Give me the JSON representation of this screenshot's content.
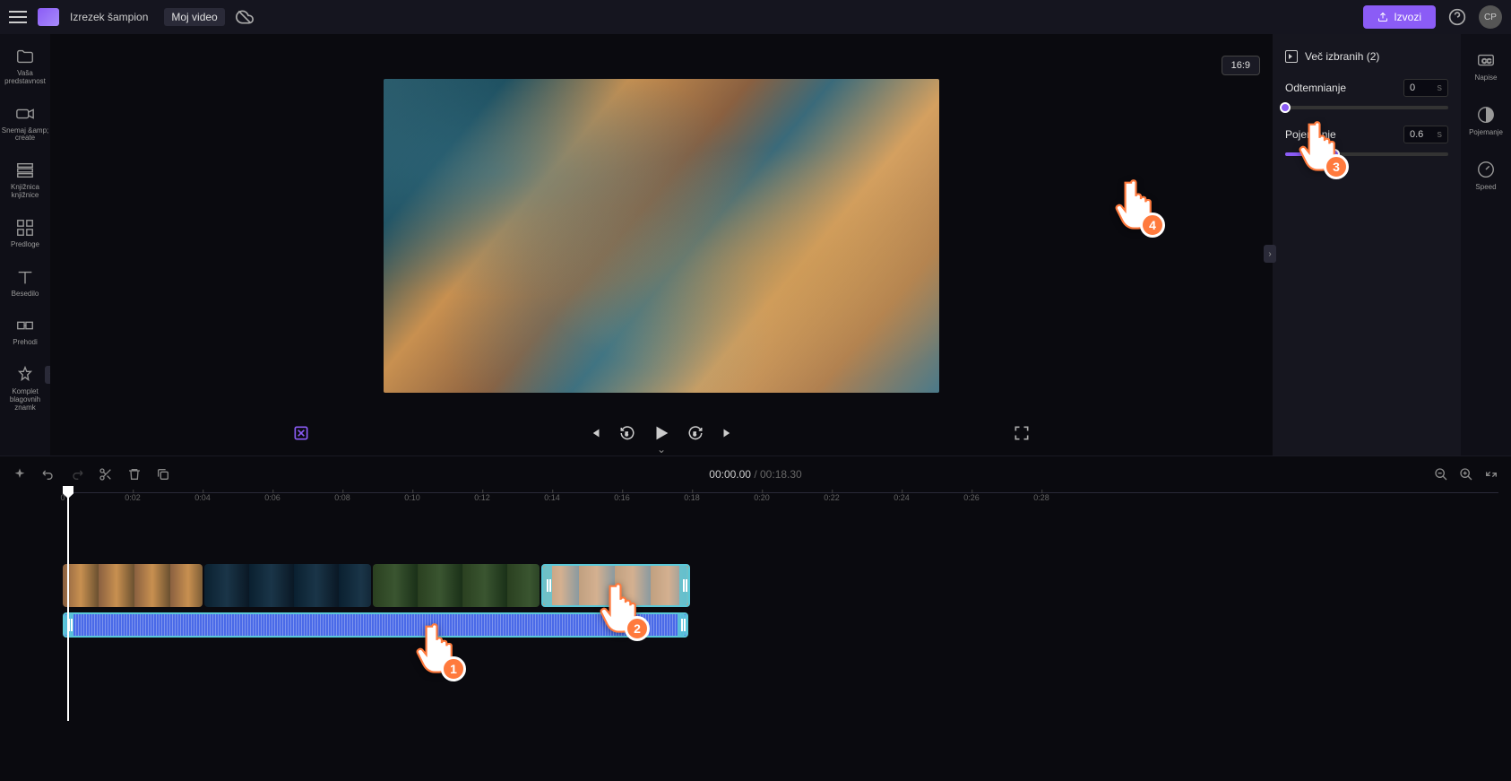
{
  "header": {
    "breadcrumb": "Izrezek šampion",
    "project_name": "Moj video",
    "export_label": "Izvozi",
    "avatar_initials": "CP"
  },
  "left_nav": {
    "items": [
      {
        "label": "Vaša predstavnost"
      },
      {
        "label": "Snemaj &amp;\ncreate"
      },
      {
        "label": "Knjižnica knjižnice"
      },
      {
        "label": "Predloge"
      },
      {
        "label": "Besedilo"
      },
      {
        "label": "Prehodi"
      },
      {
        "label": "Komplet blagovnih znamk"
      }
    ]
  },
  "preview": {
    "aspect_ratio": "16:9"
  },
  "right_panel": {
    "header": "Več izbranih (2)",
    "fade_in_label": "Odtemnianje",
    "fade_in_value": "0",
    "fade_in_unit": "s",
    "fade_out_label": "Pojemanje",
    "fade_out_value": "0.6",
    "fade_out_unit": "s"
  },
  "far_right": {
    "items": [
      {
        "label": "Napise"
      },
      {
        "label": "Pojemanje"
      },
      {
        "label": "Speed"
      }
    ]
  },
  "timeline": {
    "current_time": "00:00.00",
    "duration": "00:18.30",
    "ticks": [
      "0",
      "0:02",
      "0:04",
      "0:06",
      "0:08",
      "0:10",
      "0:12",
      "0:14",
      "0:16",
      "0:18",
      "0:20",
      "0:22",
      "0:24",
      "0:26",
      "0:28"
    ]
  },
  "cursors": {
    "c1": "1",
    "c2": "2",
    "c3": "3",
    "c4": "4"
  }
}
